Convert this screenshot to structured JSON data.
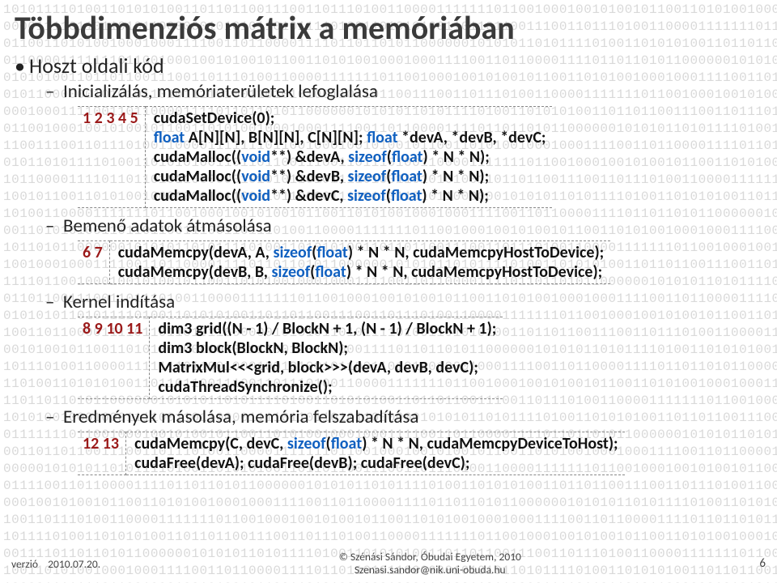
{
  "title": "Többdimenziós mátrix a memóriában",
  "bullets": {
    "b1": "Hoszt oldali kód",
    "b2a": "Inicializálás, memóriaterületek lefoglalása",
    "b2b": "Bemenő adatok átmásolása",
    "b2c": "Kernel indítása",
    "b2d": "Eredmények másolása, memória felszabadítása"
  },
  "code": {
    "block1": {
      "nums": "1\n2\n3\n4\n5",
      "l1a": "cudaSetDevice(0);",
      "l2a": "float",
      "l2b": " A[N][N], B[N][N], C[N][N]; ",
      "l2c": "float",
      "l2d": " *devA, *devB, *devC;",
      "l3a": "cudaMalloc((",
      "l3b": "void",
      "l3c": "**) &devA, ",
      "l3d": "sizeof",
      "l3e": "(",
      "l3f": "float",
      "l3g": ") * N * N);",
      "l4a": "cudaMalloc((",
      "l4b": "void",
      "l4c": "**) &devB, ",
      "l4d": "sizeof",
      "l4e": "(",
      "l4f": "float",
      "l4g": ") * N * N);",
      "l5a": "cudaMalloc((",
      "l5b": "void",
      "l5c": "**) &devC, ",
      "l5d": "sizeof",
      "l5e": "(",
      "l5f": "float",
      "l5g": ") * N * N);"
    },
    "block2": {
      "nums": "6\n7",
      "l6a": "cudaMemcpy(devA, A, ",
      "l6b": "sizeof",
      "l6c": "(",
      "l6d": "float",
      "l6e": ") * N * N, cudaMemcpyHostToDevice);",
      "l7a": "cudaMemcpy(devB, B, ",
      "l7b": "sizeof",
      "l7c": "(",
      "l7d": "float",
      "l7e": ") * N * N, cudaMemcpyHostToDevice);"
    },
    "block3": {
      "nums": "8\n9\n10\n11",
      "l8": "dim3 grid((N - 1) / BlockN + 1, (N - 1) / BlockN + 1);",
      "l9": "dim3 block(BlockN, BlockN);",
      "l10": "MatrixMul<<<grid, block>>>(devA, devB, devC);",
      "l11": "cudaThreadSynchronize();"
    },
    "block4": {
      "nums": "12\n13",
      "l12a": "cudaMemcpy(C, devC, ",
      "l12b": "sizeof",
      "l12c": "(",
      "l12d": "float",
      "l12e": ") * N * N, cudaMemcpyDeviceToHost);",
      "l13": "cudaFree(devA); cudaFree(devB); cudaFree(devC);"
    }
  },
  "footer": {
    "version_label": "verzió",
    "date": "2010.07.20.",
    "copyright": "© Szénási Sándor, Óbudai Egyetem, 2010",
    "email": "Szenasi.sandor@nik.uni-obuda.hu",
    "page": "6"
  },
  "binary_seed": "1010111101001101010100110110110011100110111010011000011111110110010001001010010110011010100100010001111001101100001111011011010110000001010101"
}
